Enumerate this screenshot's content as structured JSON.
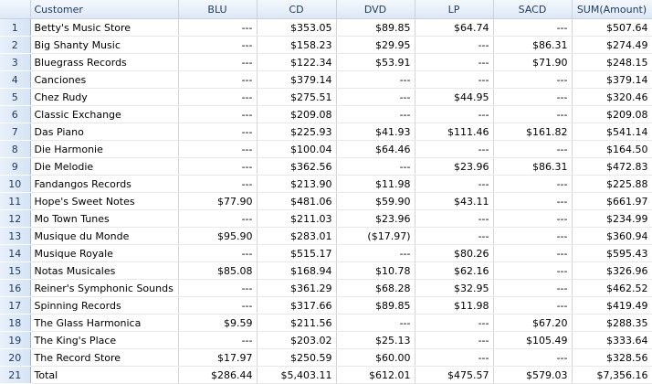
{
  "grid": {
    "columns": [
      "",
      "Customer",
      "BLU",
      "CD",
      "DVD",
      "LP",
      "SACD",
      "SUM(Amount)"
    ],
    "rows": [
      [
        "1",
        "Betty's Music Store",
        "---",
        "$353.05",
        "$89.85",
        "$64.74",
        "---",
        "$507.64"
      ],
      [
        "2",
        "Big Shanty Music",
        "---",
        "$158.23",
        "$29.95",
        "---",
        "$86.31",
        "$274.49"
      ],
      [
        "3",
        "Bluegrass Records",
        "---",
        "$122.34",
        "$53.91",
        "---",
        "$71.90",
        "$248.15"
      ],
      [
        "4",
        "Canciones",
        "---",
        "$379.14",
        "---",
        "---",
        "---",
        "$379.14"
      ],
      [
        "5",
        "Chez Rudy",
        "---",
        "$275.51",
        "---",
        "$44.95",
        "---",
        "$320.46"
      ],
      [
        "6",
        "Classic Exchange",
        "---",
        "$209.08",
        "---",
        "---",
        "---",
        "$209.08"
      ],
      [
        "7",
        "Das Piano",
        "---",
        "$225.93",
        "$41.93",
        "$111.46",
        "$161.82",
        "$541.14"
      ],
      [
        "8",
        "Die Harmonie",
        "---",
        "$100.04",
        "$64.46",
        "---",
        "---",
        "$164.50"
      ],
      [
        "9",
        "Die Melodie",
        "---",
        "$362.56",
        "---",
        "$23.96",
        "$86.31",
        "$472.83"
      ],
      [
        "10",
        "Fandangos Records",
        "---",
        "$213.90",
        "$11.98",
        "---",
        "---",
        "$225.88"
      ],
      [
        "11",
        "Hope's Sweet Notes",
        "$77.90",
        "$481.06",
        "$59.90",
        "$43.11",
        "---",
        "$661.97"
      ],
      [
        "12",
        "Mo Town Tunes",
        "---",
        "$211.03",
        "$23.96",
        "---",
        "---",
        "$234.99"
      ],
      [
        "13",
        "Musique du Monde",
        "$95.90",
        "$283.01",
        "($17.97)",
        "---",
        "---",
        "$360.94"
      ],
      [
        "14",
        "Musique Royale",
        "---",
        "$515.17",
        "---",
        "$80.26",
        "---",
        "$595.43"
      ],
      [
        "15",
        "Notas Musicales",
        "$85.08",
        "$168.94",
        "$10.78",
        "$62.16",
        "---",
        "$326.96"
      ],
      [
        "16",
        "Reiner's Symphonic Sounds",
        "---",
        "$361.29",
        "$68.28",
        "$32.95",
        "---",
        "$462.52"
      ],
      [
        "17",
        "Spinning Records",
        "---",
        "$317.66",
        "$89.85",
        "$11.98",
        "---",
        "$419.49"
      ],
      [
        "18",
        "The Glass Harmonica",
        "$9.59",
        "$211.56",
        "---",
        "---",
        "$67.20",
        "$288.35"
      ],
      [
        "19",
        "The King's Place",
        "---",
        "$203.02",
        "$25.13",
        "---",
        "$105.49",
        "$333.64"
      ],
      [
        "20",
        "The Record Store",
        "$17.97",
        "$250.59",
        "$60.00",
        "---",
        "---",
        "$328.56"
      ],
      [
        "21",
        "Total",
        "$286.44",
        "$5,403.11",
        "$612.01",
        "$475.57",
        "$579.03",
        "$7,356.16"
      ]
    ]
  }
}
